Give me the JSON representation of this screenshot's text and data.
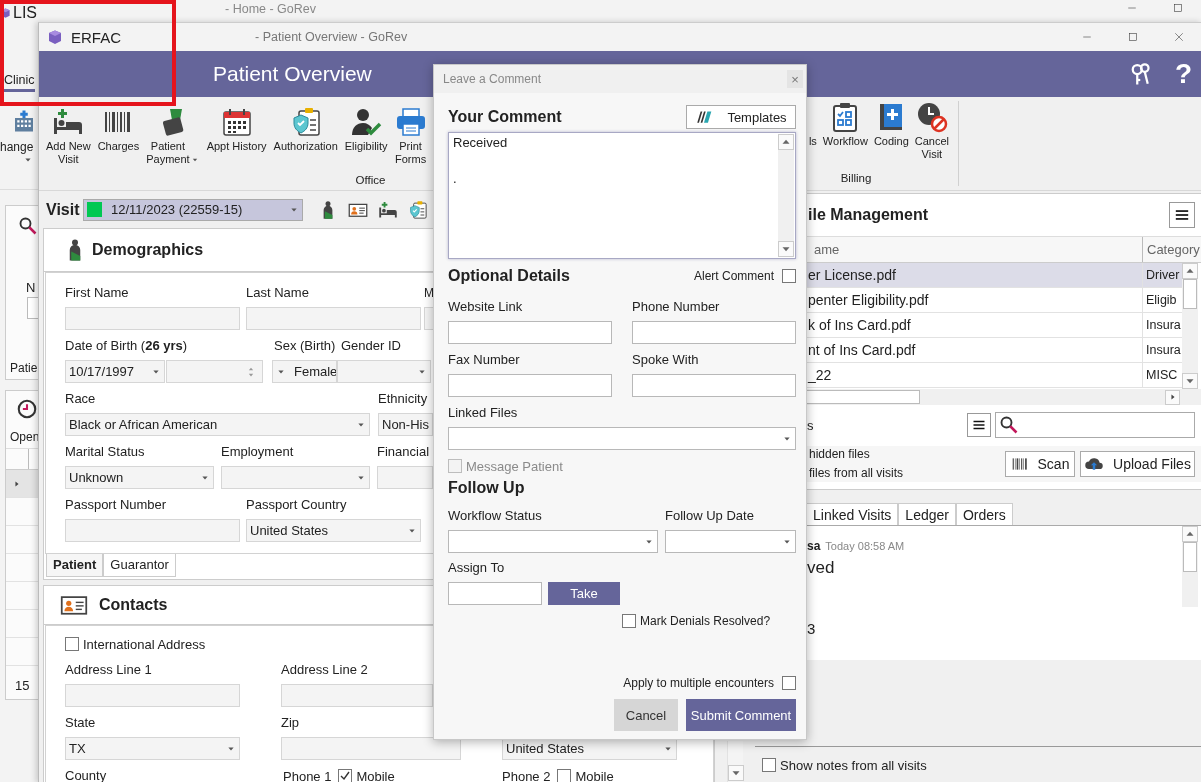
{
  "background_window": {
    "app": "LIS",
    "title": "- Home - GoRev",
    "tab": "Clinic",
    "ribbon_item": "hange",
    "search_label": "N",
    "search_tab": "Patie",
    "list_tab": "Open",
    "list_rows": [
      {
        "selected": true
      },
      {
        "selected": false
      },
      {
        "selected": false
      },
      {
        "selected": false
      },
      {
        "selected": false
      },
      {
        "selected": false
      },
      {
        "selected": false
      }
    ],
    "list_footer": "15"
  },
  "window": {
    "app": "ERFAC",
    "title": "- Patient Overview - GoRev",
    "header": "Patient Overview",
    "help": "?"
  },
  "ribbon": {
    "groups": [
      {
        "label": "Office",
        "items": [
          {
            "label": "Add New\nVisit"
          },
          {
            "label": "Charges"
          },
          {
            "label": "Patient\nPayment",
            "menu": true
          },
          {
            "label": "Appt History"
          },
          {
            "label": "Authorization"
          },
          {
            "label": "Eligibility"
          },
          {
            "label": "Print\nForms"
          }
        ]
      },
      {
        "label": "Billing",
        "items": [
          {
            "label": "ls"
          },
          {
            "label": "Workflow"
          },
          {
            "label": "Coding"
          },
          {
            "label": "Cancel\nVisit"
          }
        ]
      }
    ]
  },
  "visit": {
    "label": "Visit",
    "value": "12/11/2023 (22559-15)",
    "color": "#00c853"
  },
  "demographics": {
    "title": "Demographics",
    "first_name_label": "First Name",
    "last_name_label": "Last Name",
    "middle_label": "M",
    "dob_label": "Date of Birth (**26 yrs**)",
    "dob": "10/17/1997",
    "sex_label": "Sex (Birth)",
    "gender_label": "Gender ID",
    "sex": "Female",
    "race_label": "Race",
    "race": "Black or African American",
    "ethnicity_label": "Ethnicity",
    "ethnicity": "Non-His",
    "marital_label": "Marital Status",
    "marital_status": "Unknown",
    "employment_label": "Employment",
    "financial_label": "Financial",
    "passport_number_label": "Passport Number",
    "passport_country_label": "Passport Country",
    "passport_country": "United States",
    "tabs": [
      {
        "label": "Patient",
        "selected": true
      },
      {
        "label": "Guarantor",
        "selected": false
      }
    ]
  },
  "contacts": {
    "title": "Contacts",
    "international_address": {
      "label": "International Address",
      "checked": false
    },
    "address_line_1_label": "Address Line 1",
    "address_line_2_label": "Address Line 2",
    "state_label": "State",
    "state": "TX",
    "zip_label": "Zip",
    "country": "United States",
    "county_label": "County",
    "phones": [
      {
        "label": "Phone 1",
        "mobile_label": "Mobile",
        "checked": true
      },
      {
        "label": "Phone 2",
        "mobile_label": "Mobile",
        "checked": false
      }
    ]
  },
  "file_management": {
    "title": "ile Management",
    "columns": [
      "ame",
      "Category"
    ],
    "rows": [
      {
        "name": "er License.pdf",
        "category": "Driver",
        "selected": true
      },
      {
        "name": "penter Eligibility.pdf",
        "category": "Eligib",
        "selected": false
      },
      {
        "name": "k of Ins Card.pdf",
        "category": "Insura",
        "selected": false
      },
      {
        "name": "nt of Ins Card.pdf",
        "category": "Insura",
        "selected": false
      },
      {
        "name": "_22",
        "category": "MISC",
        "selected": false
      }
    ],
    "views_label": "s",
    "options": [
      "hidden files",
      "files from all visits"
    ],
    "scan": "Scan",
    "upload": "Upload Files"
  },
  "lower_tabs": [
    {
      "label": "Linked Visits",
      "selected": false
    },
    {
      "label": "Ledger",
      "selected": false
    },
    {
      "label": "Orders",
      "selected": false
    }
  ],
  "note": {
    "author": "sa",
    "time": "Today 08:58 AM",
    "text": "ved",
    "extra": "3"
  },
  "show_notes_all_visits": {
    "label": "Show notes from all visits",
    "checked": false
  },
  "dialog": {
    "title": "Leave a Comment",
    "close": "×",
    "section": "Your Comment",
    "templates": "Templates",
    "comment": "Received\n\n.",
    "optional": "Optional Details",
    "alert": {
      "label": "Alert Comment",
      "checked": false
    },
    "website_label": "Website Link",
    "phone_label": "Phone Number",
    "fax_label": "Fax Number",
    "spoke_label": "Spoke With",
    "linked_files_label": "Linked Files",
    "message_patient": {
      "label": "Message Patient",
      "checked": false,
      "disabled": true
    },
    "follow_up": "Follow Up",
    "workflow_label": "Workflow Status",
    "follow_up_date_label": "Follow Up Date",
    "assign_label": "Assign To",
    "take": "Take",
    "mark_denials": {
      "label": "Mark Denials Resolved?",
      "checked": false
    },
    "multiple": {
      "label": "Apply to multiple encounters",
      "checked": false
    },
    "cancel": "Cancel",
    "submit": "Submit Comment"
  }
}
